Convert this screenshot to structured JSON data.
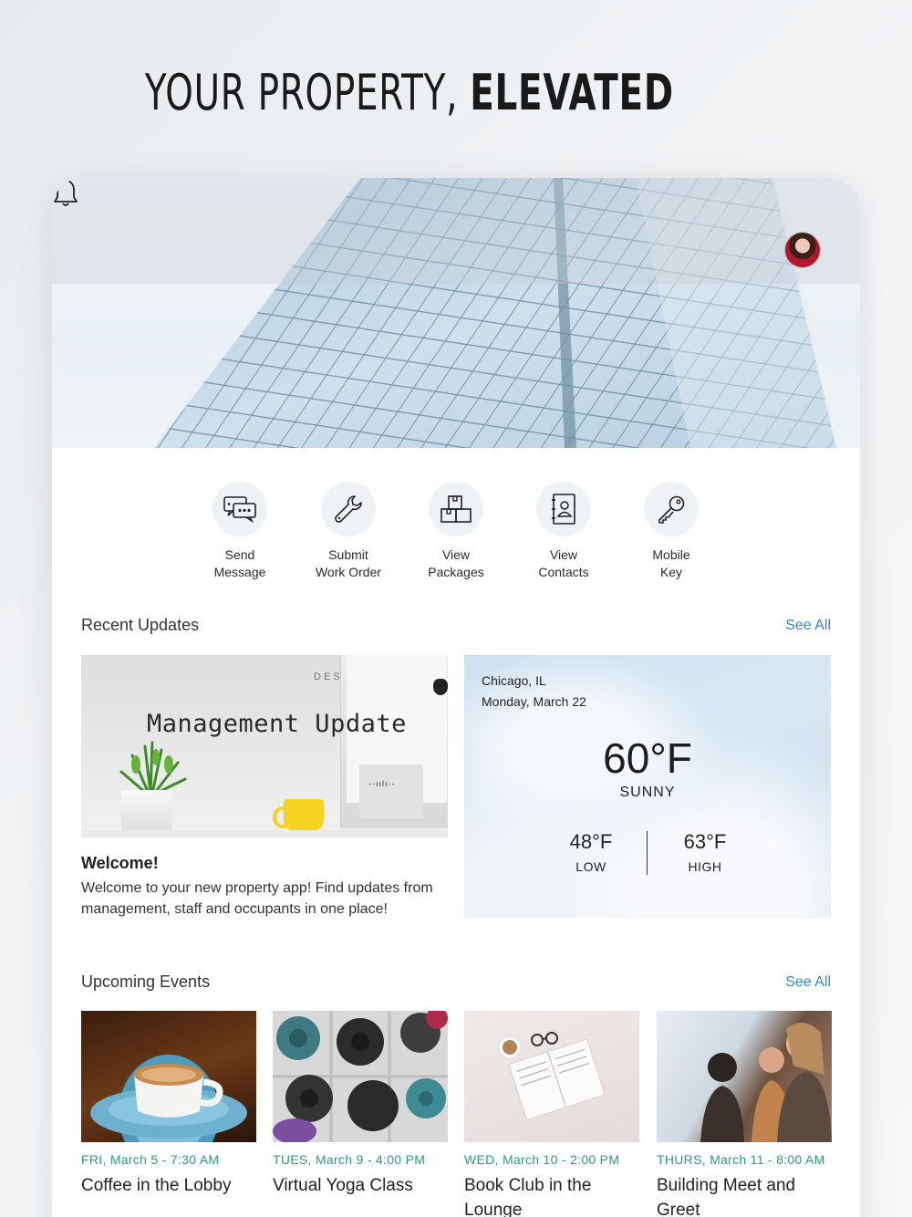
{
  "headline": {
    "light": "YOUR PROPERTY,",
    "bold": "ELEVATED"
  },
  "header": {
    "bell_icon": "bell-icon",
    "avatar": "user-avatar"
  },
  "quick_actions": [
    {
      "line1": "Send",
      "line2": "Message",
      "icon": "chat-bubbles-icon"
    },
    {
      "line1": "Submit",
      "line2": "Work Order",
      "icon": "wrench-icon"
    },
    {
      "line1": "View",
      "line2": "Packages",
      "icon": "boxes-icon"
    },
    {
      "line1": "View",
      "line2": "Contacts",
      "icon": "contact-book-icon"
    },
    {
      "line1": "Mobile",
      "line2": "Key",
      "icon": "key-icon"
    }
  ],
  "recent_updates": {
    "title": "Recent Updates",
    "see_all": "See All",
    "card": {
      "image_title": "Management Update",
      "monitor_text": "DES",
      "heading": "Welcome!",
      "body": "Welcome to your new property app! Find updates from management, staff and occupants in one place!"
    }
  },
  "weather": {
    "city": "Chicago, IL",
    "date": "Monday, March 22",
    "temp": "60°F",
    "condition": "SUNNY",
    "low": "48°F",
    "low_label": "LOW",
    "high": "63°F",
    "high_label": "HIGH"
  },
  "upcoming_events": {
    "title": "Upcoming Events",
    "see_all": "See All",
    "items": [
      {
        "when": "FRI, March 5 - 7:30 AM",
        "name": "Coffee in the Lobby"
      },
      {
        "when": "TUES, March 9 - 4:00 PM",
        "name": "Virtual Yoga Class"
      },
      {
        "when": "WED, March 10 - 2:00 PM",
        "name": "Book Club in the Lounge"
      },
      {
        "when": "THURS, March 11 - 8:00 AM",
        "name": "Building Meet and Greet"
      }
    ]
  },
  "colors": {
    "accent_link": "#2f86d6",
    "event_date": "#2a9d7b"
  }
}
